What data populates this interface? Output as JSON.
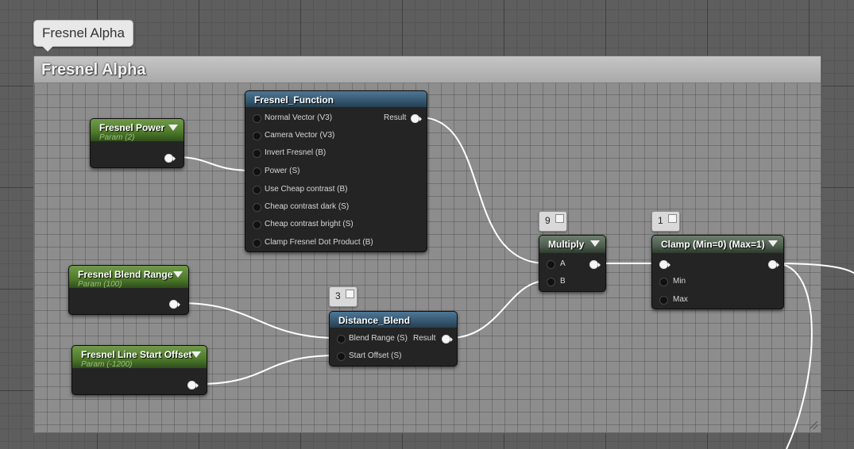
{
  "comment": {
    "bubble_text": "Fresnel Alpha",
    "title": "Fresnel Alpha"
  },
  "nodes": {
    "fresnel_power": {
      "title": "Fresnel Power",
      "subtitle": "Param (2)"
    },
    "fresnel_blend_range": {
      "title": "Fresnel Blend Range",
      "subtitle": "Param (100)"
    },
    "fresnel_line_start_offset": {
      "title": "Fresnel Line Start Offset",
      "subtitle": "Param (-1200)"
    },
    "fresnel_function": {
      "title": "Fresnel_Function",
      "inputs": [
        "Normal Vector (V3)",
        "Camera Vector (V3)",
        "Invert Fresnel (B)",
        "Power (S)",
        "Use Cheap contrast (B)",
        "Cheap contrast dark (S)",
        "Cheap contrast bright (S)",
        "Clamp Fresnel Dot Product (B)"
      ],
      "output": "Result"
    },
    "distance_blend": {
      "title": "Distance_Blend",
      "preview_value": "3",
      "inputs": [
        "Blend Range (S)",
        "Start Offset (S)"
      ],
      "output": "Result"
    },
    "multiply": {
      "title": "Multiply",
      "preview_value": "9",
      "inputs": [
        "A",
        "B"
      ]
    },
    "clamp": {
      "title": "Clamp (Min=0) (Max=1)",
      "preview_value": "1",
      "inputs": [
        "Min",
        "Max"
      ]
    }
  },
  "colors": {
    "parameter_header": "#4d7a2a",
    "function_header": "#35576f",
    "math_header": "#4e5e4e",
    "wire": "#ffffff"
  }
}
